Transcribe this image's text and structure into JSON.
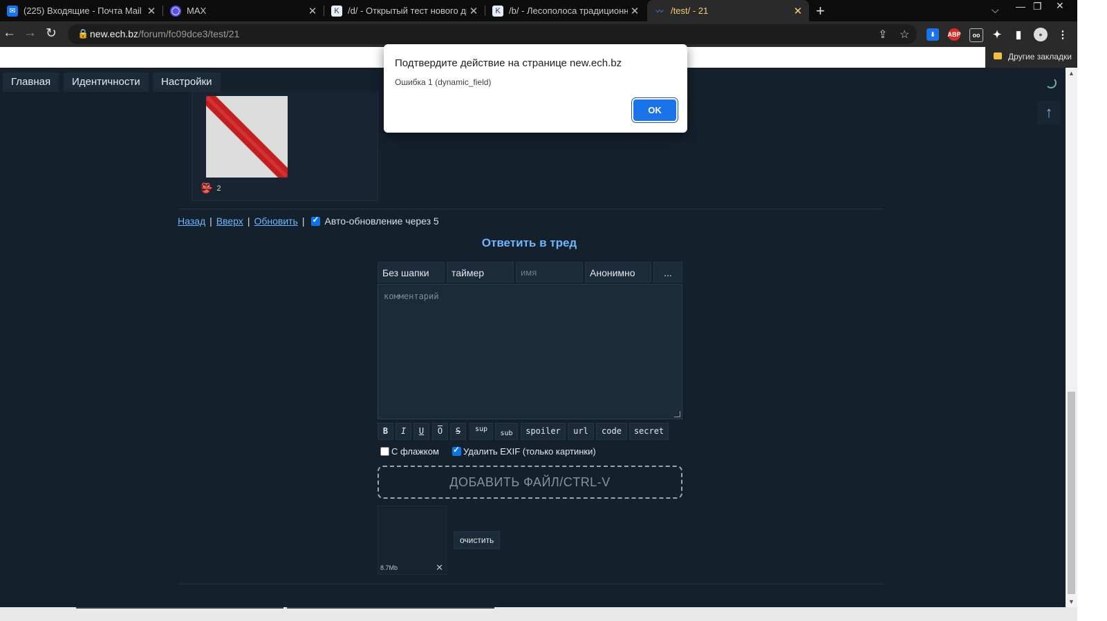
{
  "browser": {
    "tabs": [
      {
        "title": "(225) Входящие - Почта Mail",
        "icon": "mail-icon",
        "active": false
      },
      {
        "title": "MAX",
        "icon": "max-icon",
        "active": false
      },
      {
        "title": "/d/ - Открытый тест нового дви",
        "icon": "ech-icon",
        "active": false
      },
      {
        "title": "/b/ - Лесополоса традиционна",
        "icon": "ech-icon",
        "active": false
      },
      {
        "title": "/test/ - 21",
        "icon": "wave-icon",
        "active": true
      }
    ],
    "url_host": "new.ech.bz",
    "url_path": "/forum/fc09dce3/test/21",
    "bookmarks_label": "Другие закладки",
    "colors": {
      "chrome_dark": "#2a2a2a",
      "tabstrip": "#0c0c0c",
      "accent": "#1a73e8"
    }
  },
  "nav": {
    "items": [
      "Главная",
      "Идентичности",
      "Настройки"
    ],
    "scroll_up_icon": "arrow-up-icon"
  },
  "post": {
    "reaction_count": "2"
  },
  "links": {
    "back": "Назад",
    "up": "Вверх",
    "refresh": "Обновить",
    "sep": "|",
    "autoupdate": "Авто-обновление через 5"
  },
  "form": {
    "title": "Ответить в тред",
    "fields": {
      "subject": "Без шапки",
      "timer": "таймер",
      "name_placeholder": "имя",
      "trip": "Анонимно",
      "more": "..."
    },
    "comment_placeholder": "комментарий",
    "format_buttons": [
      "B",
      "I",
      "U",
      "O",
      "S",
      "sup",
      "sub",
      "spoiler",
      "url",
      "code",
      "secret"
    ],
    "flag_label": "С флажком",
    "exif_label": "Удалить EXIF (только картинки)",
    "dropzone": "ДОБАВИТЬ ФАЙЛ/CTRL-V",
    "file_size": "8.7Mb",
    "clear_label": "очистить",
    "link_color": "#6eb6ff",
    "page_bg": "#14202c"
  },
  "dialog": {
    "title": "Подтвердите действие на странице new.ech.bz",
    "message": "Ошибка 1 (dynamic_field)",
    "ok": "OK"
  }
}
